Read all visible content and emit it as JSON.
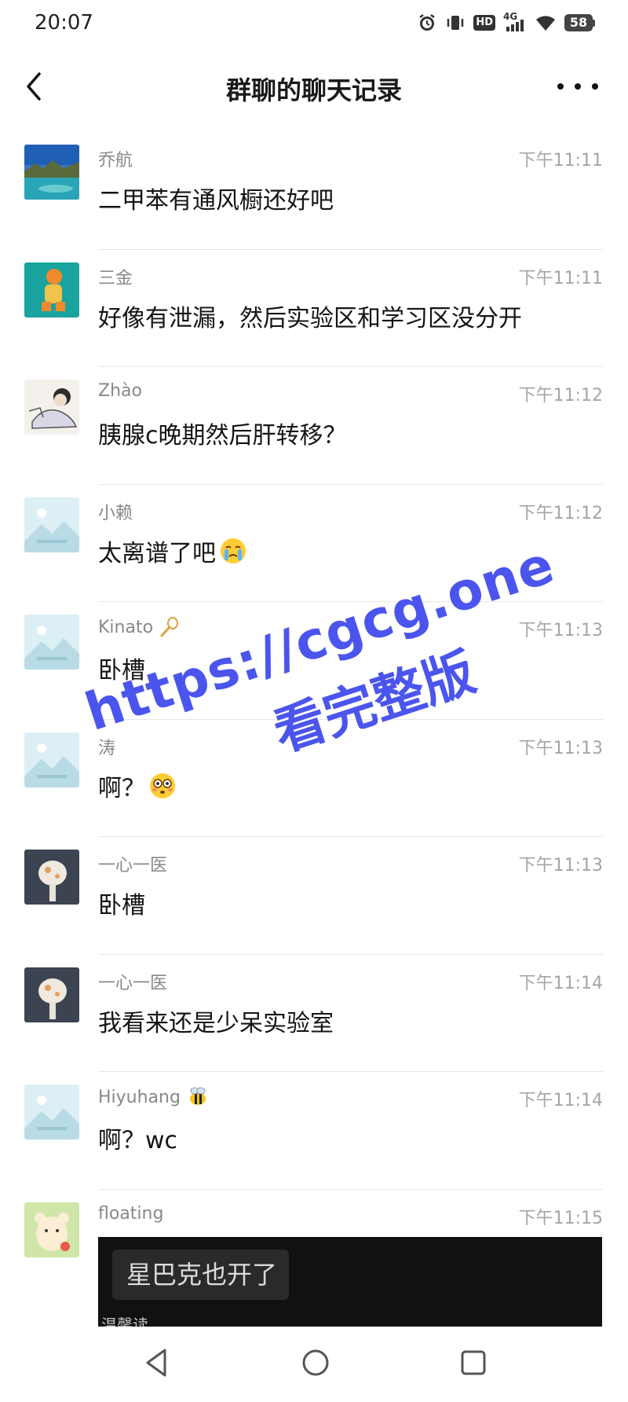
{
  "status_bar": {
    "time": "20:07",
    "battery": "58",
    "network": "4G",
    "hd": "HD"
  },
  "header": {
    "title": "群聊的聊天记录"
  },
  "messages": [
    {
      "sender": "乔航",
      "time": "下午11:11",
      "text": "二甲苯有通风橱还好吧",
      "avatar": "landscape-lake"
    },
    {
      "sender": "三金",
      "time": "下午11:11",
      "text": "好像有泄漏，然后实验区和学习区没分开",
      "avatar": "teal-cartoon"
    },
    {
      "sender": "Zhào",
      "time": "下午11:12",
      "text": "胰腺c晚期然后肝转移？",
      "avatar": "sketch-boy"
    },
    {
      "sender": "小赖",
      "time": "下午11:12",
      "text": "太离谱了吧",
      "avatar": "placeholder-mountain",
      "text_emoji": "crying-face"
    },
    {
      "sender": "Kinato",
      "time": "下午11:13",
      "text": "卧槽",
      "avatar": "placeholder-mountain",
      "sender_emoji": "racket"
    },
    {
      "sender": "涛",
      "time": "下午11:13",
      "text": "啊？",
      "avatar": "placeholder-mountain",
      "text_emoji": "flushed-face"
    },
    {
      "sender": "一心一医",
      "time": "下午11:13",
      "text": "卧槽",
      "avatar": "cat-photo"
    },
    {
      "sender": "一心一医",
      "time": "下午11:14",
      "text": "我看来还是少呆实验室",
      "avatar": "cat-photo"
    },
    {
      "sender": "Hiyuhang",
      "time": "下午11:14",
      "text": "啊？wc",
      "avatar": "placeholder-mountain",
      "sender_emoji": "bee"
    },
    {
      "sender": "floating",
      "time": "下午11:15",
      "text": "",
      "avatar": "cartoon-bear"
    }
  ],
  "image_preview": {
    "caption": "星巴克也开了",
    "fragment": "温馨读"
  },
  "watermark": {
    "url": "https://cgcg.one",
    "sub": "看完整版"
  },
  "colors": {
    "watermark": "#4b55ee",
    "time": "#a5a5a5",
    "sender": "#888888"
  }
}
